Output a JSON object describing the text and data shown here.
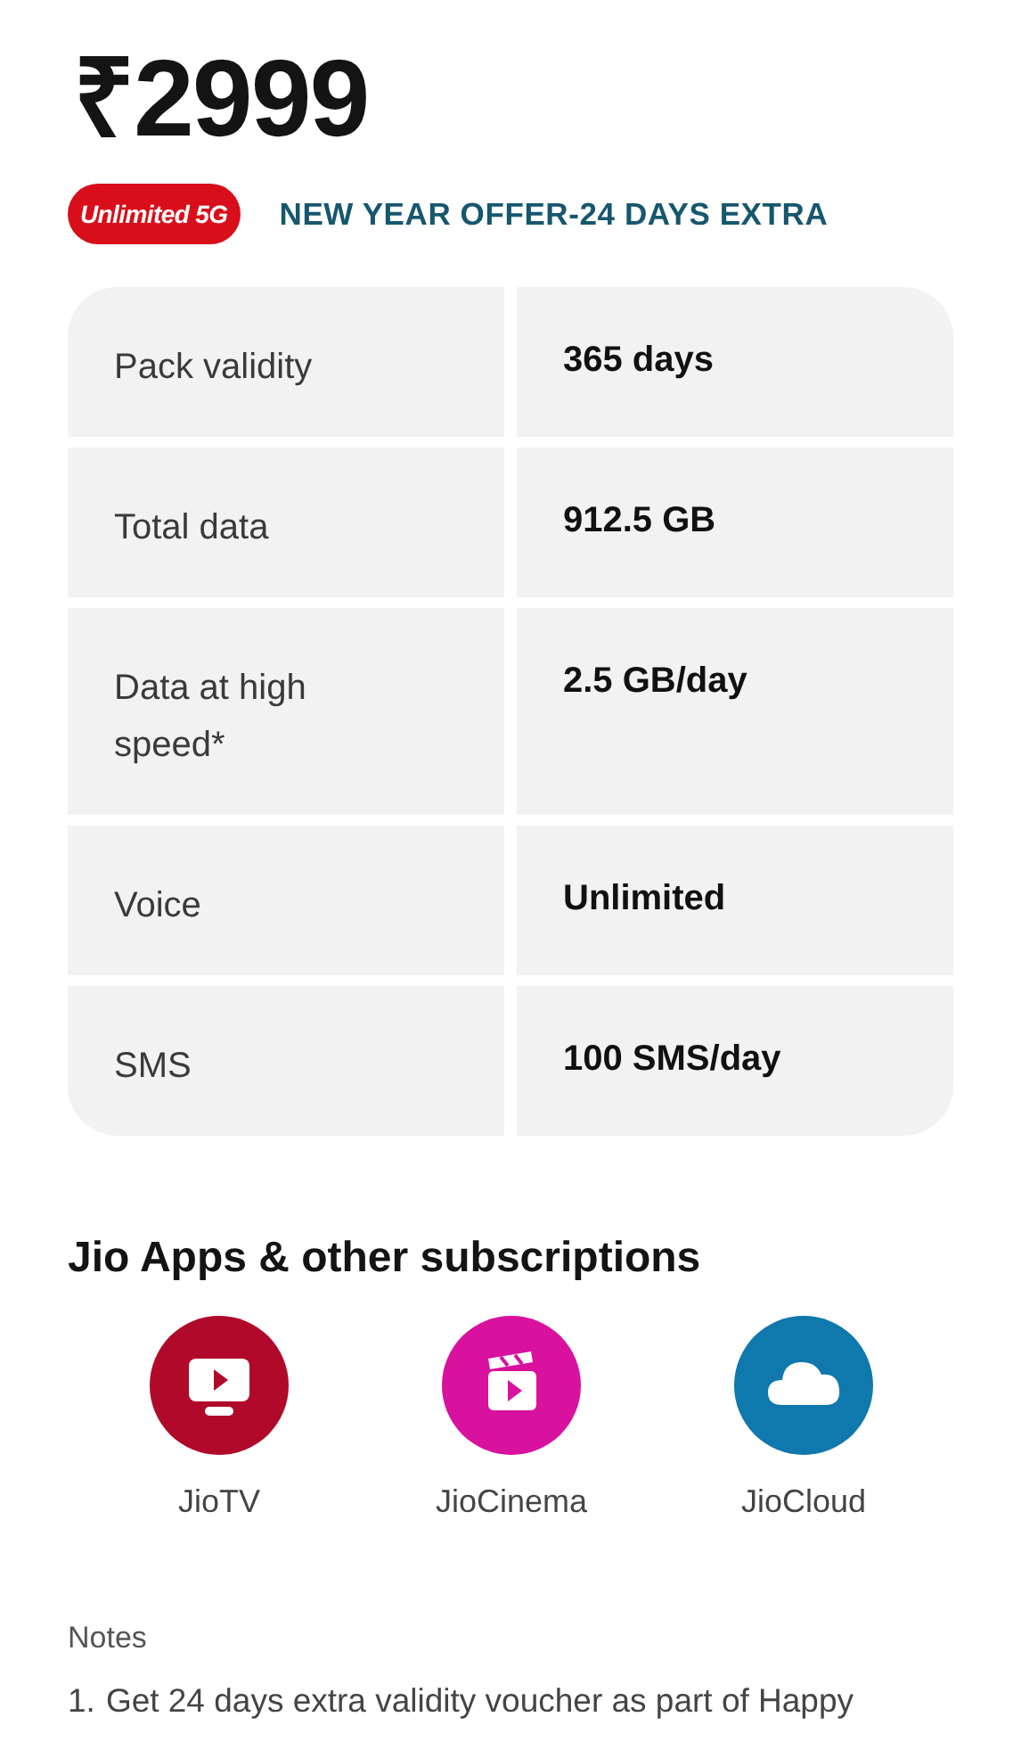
{
  "price": "₹2999",
  "badge": "Unlimited 5G",
  "offer": "NEW YEAR OFFER-24 DAYS EXTRA",
  "benefits": [
    {
      "label": "Pack validity",
      "value": "365 days"
    },
    {
      "label": "Total data",
      "value": "912.5 GB"
    },
    {
      "label": "Data at high speed*",
      "value": "2.5 GB/day"
    },
    {
      "label": "Voice",
      "value": "Unlimited"
    },
    {
      "label": "SMS",
      "value": "100 SMS/day"
    }
  ],
  "apps_heading": "Jio Apps & other subscriptions",
  "apps": [
    {
      "name": "JioTV",
      "kind": "tv",
      "color": "#b0092a"
    },
    {
      "name": "JioCinema",
      "kind": "cinema",
      "color": "#d8119e"
    },
    {
      "name": "JioCloud",
      "kind": "cloud",
      "color": "#0f78ad"
    }
  ],
  "notes": {
    "title": "Notes",
    "items": [
      {
        "number": "1.",
        "text": "Get 24 days extra validity voucher as part of Happy"
      }
    ]
  }
}
